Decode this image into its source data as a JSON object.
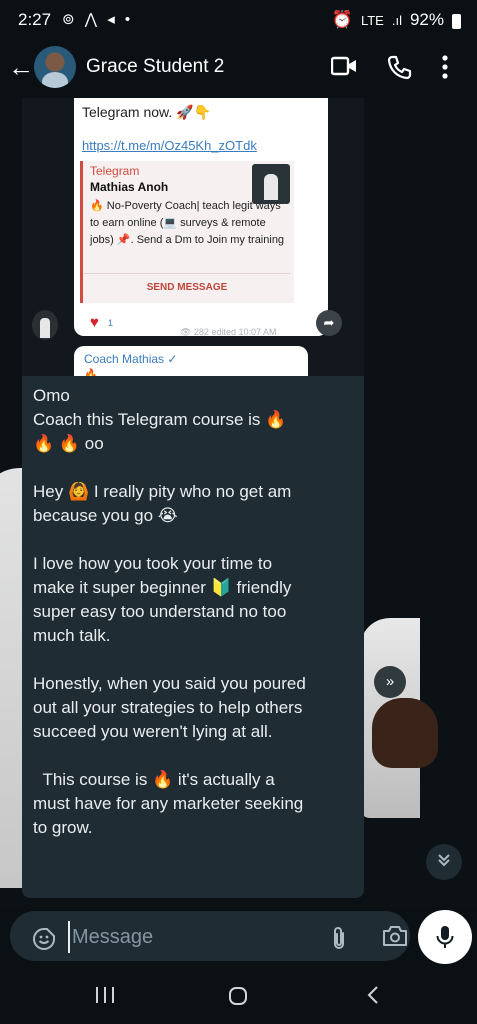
{
  "status_bar": {
    "time": "2:27",
    "left_icons": "⊚ ⋀ ◂ •",
    "lte": "LTE",
    "signal": ".ıl",
    "battery": "92%"
  },
  "header": {
    "contact_name": "Grace Student 2",
    "icons": [
      "back-arrow-icon",
      "video-call-icon",
      "voice-call-icon",
      "more-options-icon"
    ]
  },
  "forwarded_screenshot": {
    "text_top": "Telegram now. 🚀👇",
    "link": "https://t.me/m/Oz45Kh_zOTdk",
    "preview_source": "Telegram",
    "preview_name": "Mathias Anoh",
    "preview_description": "🔥 No-Poverty Coach| teach legit ways to earn online (💻 surveys & remote jobs) 📌. Send a Dm to Join my training",
    "preview_action": "SEND MESSAGE",
    "reaction": "♥",
    "reaction_count": "1",
    "meta": "👁 282  edited 10:07 AM",
    "next_sender": "Coach Mathias ✓",
    "next_preview": "🔥 ..."
  },
  "message": {
    "text": "Omo\nCoach this Telegram course is 🔥\n🔥 🔥 oo\n\nHey 🙆 I really pity who no get am\nbecause you go 😭\n\nI love how you took your time to\nmake it super beginner 🔰 friendly\nsuper easy too understand no too\nmuch talk.\n\nHonestly, when you said you poured\nout all your strategies to help others\nsucceed you weren't lying at all.\n\n  This course is 🔥 it's actually a\nmust have for any marketer seeking\nto grow."
  },
  "composer": {
    "placeholder": "Message"
  },
  "colors": {
    "background": "#0b1014",
    "incoming_bubble": "#1f2c34",
    "text": "#e9edef",
    "muted": "#8696a0"
  }
}
